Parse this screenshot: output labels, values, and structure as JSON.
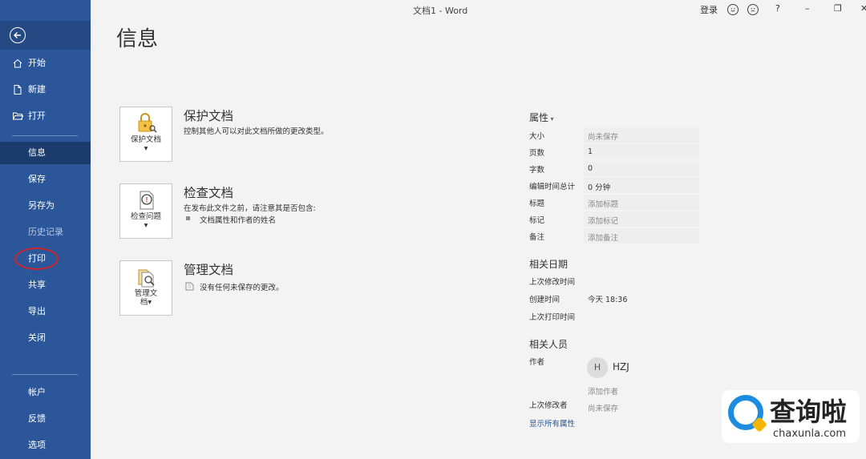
{
  "window": {
    "title": "文档1  -  Word",
    "sign_in": "登录",
    "help": "?",
    "minimize": "–",
    "restore": "❐",
    "close": "✕"
  },
  "sidebar": {
    "back_icon": "back-arrow-icon",
    "items": [
      {
        "label": "开始",
        "icon": "home-icon"
      },
      {
        "label": "新建",
        "icon": "new-document-icon"
      },
      {
        "label": "打开",
        "icon": "open-folder-icon"
      },
      {
        "label": "信息",
        "active": true
      },
      {
        "label": "保存"
      },
      {
        "label": "另存为"
      },
      {
        "label": "历史记录",
        "disabled": true
      },
      {
        "label": "打印"
      },
      {
        "label": "共享"
      },
      {
        "label": "导出"
      },
      {
        "label": "关闭"
      },
      {
        "label": "帐户"
      },
      {
        "label": "反馈"
      },
      {
        "label": "选项"
      }
    ],
    "bg_color": "#2b579a"
  },
  "page": {
    "title": "信息"
  },
  "sections": [
    {
      "button_label": "保护文档",
      "title": "保护文档",
      "desc": "控制其他人可以对此文档所做的更改类型。"
    },
    {
      "button_label": "检查问题",
      "title": "检查文档",
      "desc": "在发布此文件之前，请注意其是否包含:",
      "bullet": "文档属性和作者的姓名"
    },
    {
      "button_label_1": "管理文",
      "button_label_2": "档",
      "title": "管理文档",
      "desc": "没有任何未保存的更改。"
    }
  ],
  "properties": {
    "header": "属性",
    "rows": [
      {
        "label": "大小",
        "value": "尚未保存"
      },
      {
        "label": "页数",
        "value": "1"
      },
      {
        "label": "字数",
        "value": "0"
      },
      {
        "label": "编辑时间总计",
        "value": "0 分钟"
      },
      {
        "label": "标题",
        "value": "添加标题"
      },
      {
        "label": "标记",
        "value": "添加标记"
      },
      {
        "label": "备注",
        "value": "添加备注"
      }
    ],
    "dates_header": "相关日期",
    "dates": [
      {
        "label": "上次修改时间",
        "value": ""
      },
      {
        "label": "创建时间",
        "value": "今天 18:36"
      },
      {
        "label": "上次打印时间",
        "value": ""
      }
    ],
    "people_header": "相关人员",
    "author_label": "作者",
    "author_initial": "H",
    "author_name": "HZJ",
    "add_author": "添加作者",
    "last_modified_by_label": "上次修改者",
    "last_modified_by_value": "尚未保存",
    "show_all": "显示所有属性"
  },
  "watermark": {
    "brand": "查询啦",
    "domain": "chaxunla.com"
  }
}
